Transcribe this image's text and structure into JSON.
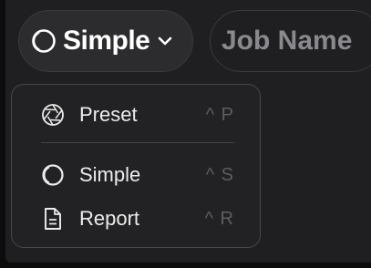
{
  "mode_button": {
    "label": "Simple",
    "icon": "simple-rings-icon",
    "chevron": "chevron-down-icon"
  },
  "job_name": {
    "placeholder": "Job Name"
  },
  "menu": {
    "items": [
      {
        "label": "Preset",
        "shortcut": "^ P",
        "icon": "aperture-icon"
      },
      {
        "label": "Simple",
        "shortcut": "^ S",
        "icon": "simple-rings-icon"
      },
      {
        "label": "Report",
        "shortcut": "^ R",
        "icon": "document-icon"
      }
    ]
  },
  "colors": {
    "background": "#1f1f21",
    "menu_background": "#222224",
    "text": "#ececec",
    "shortcut": "#5e5e62",
    "placeholder": "#8a8a8e"
  }
}
